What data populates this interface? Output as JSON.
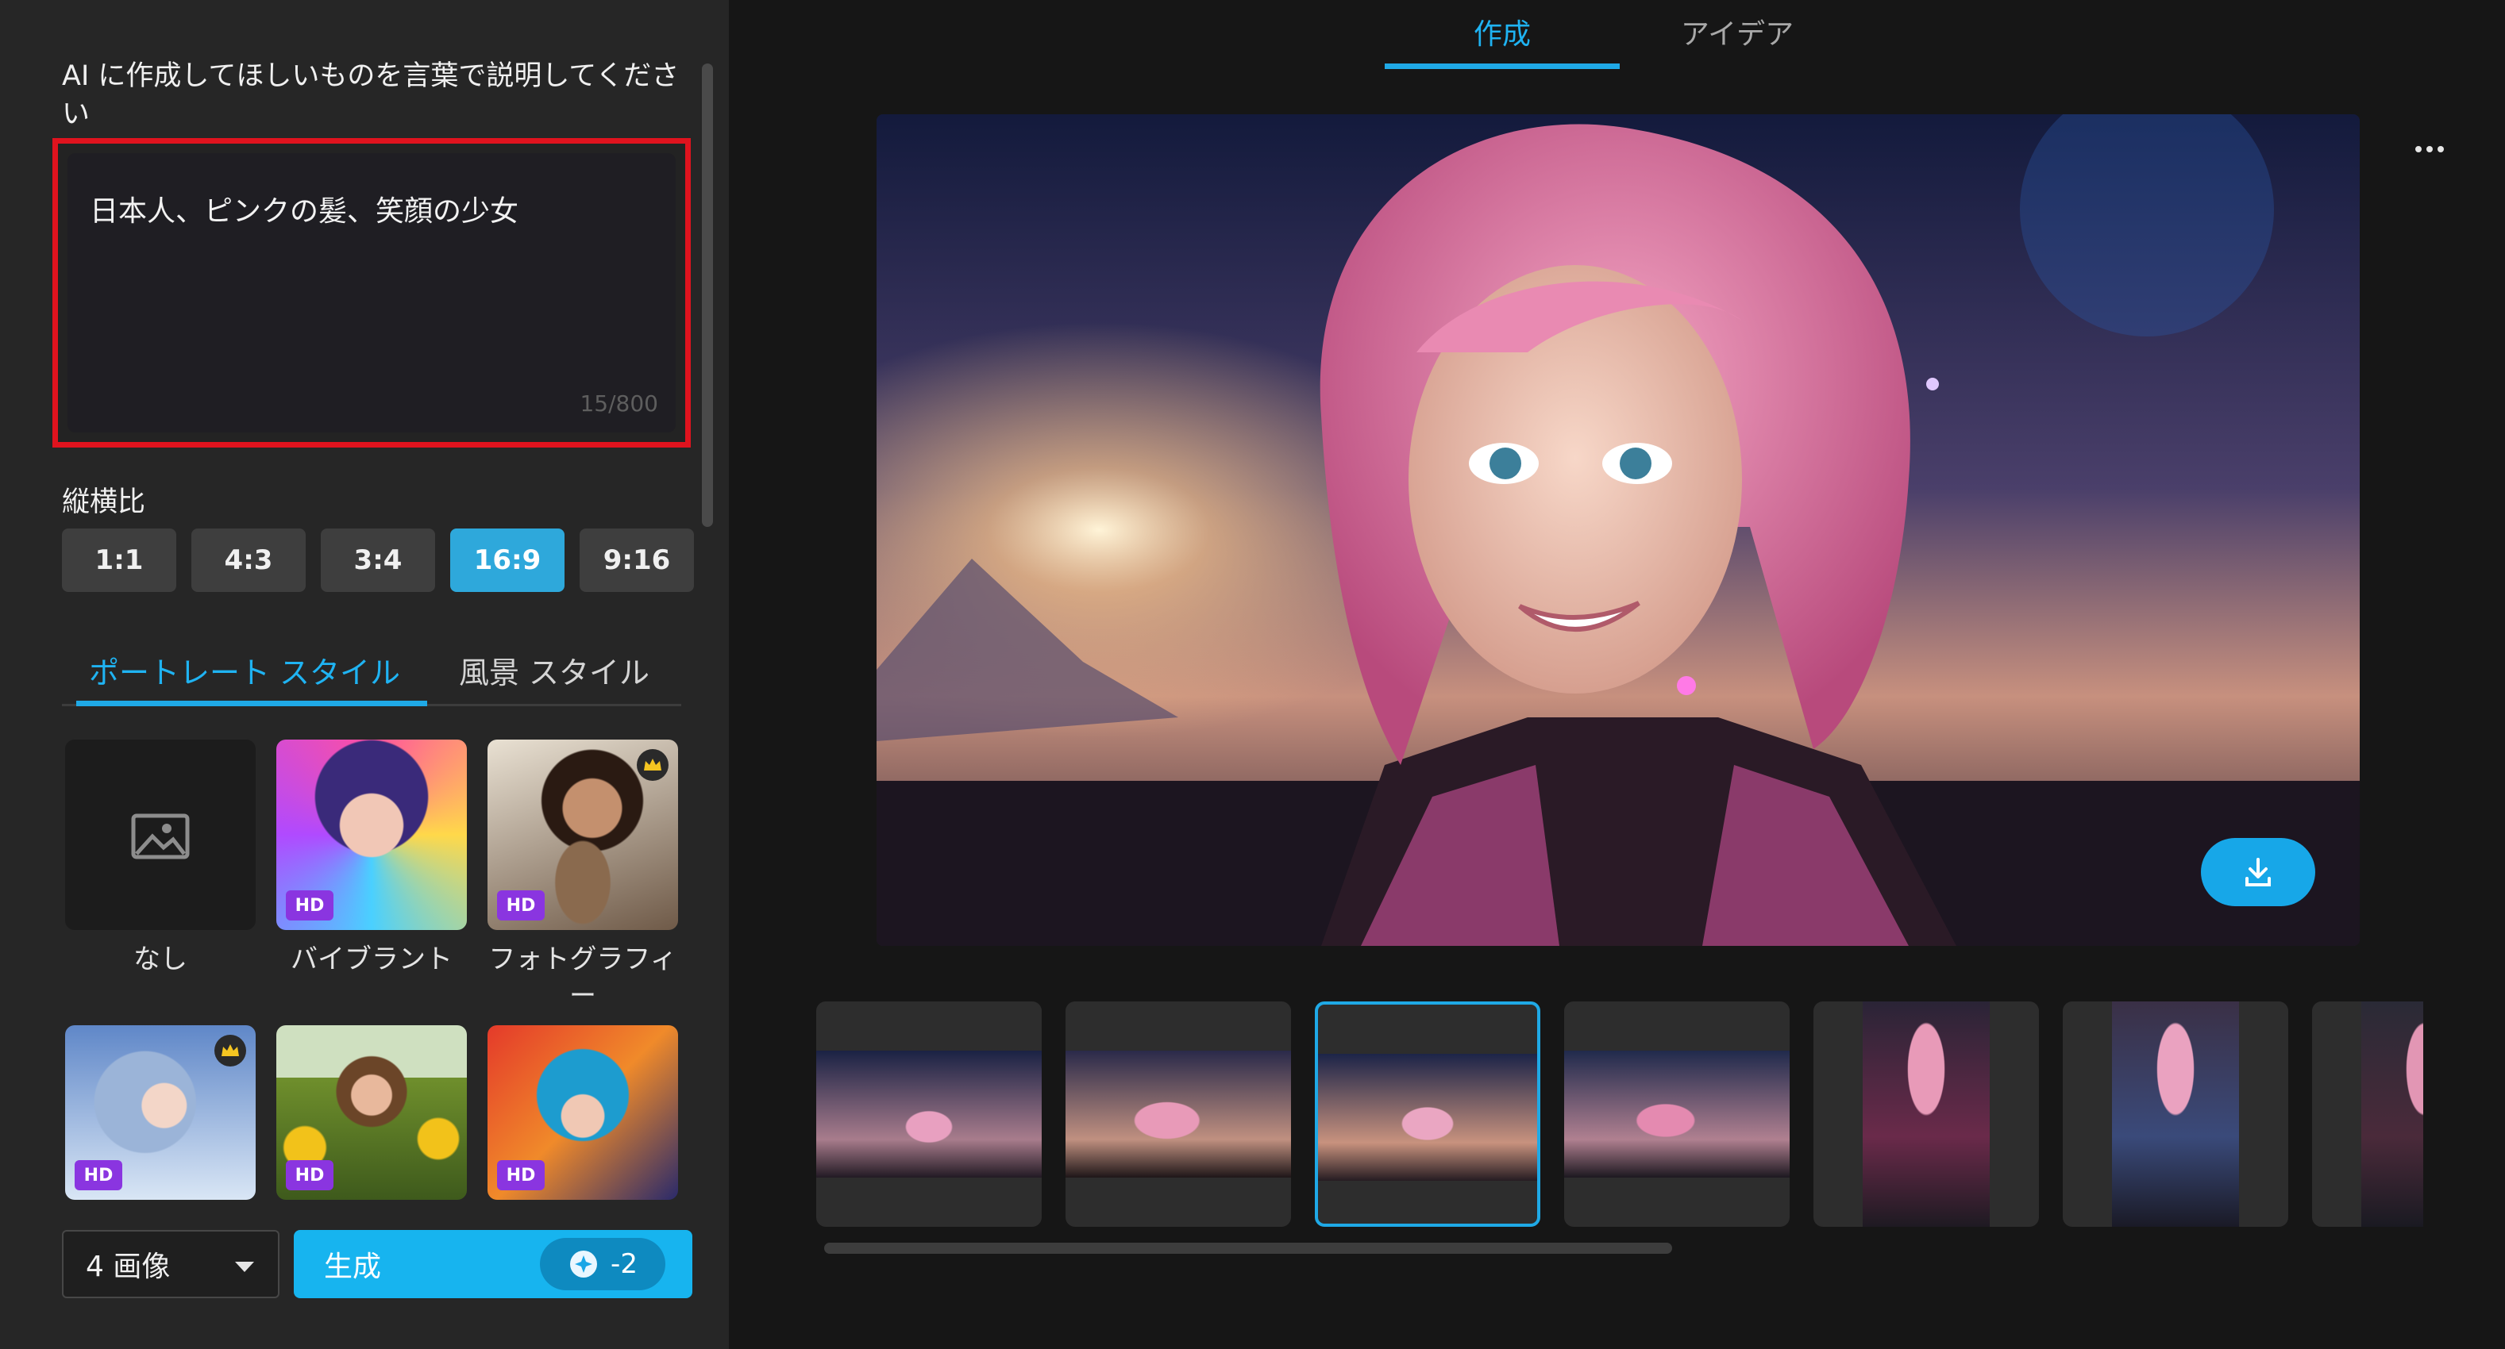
{
  "left_panel": {
    "prompt_label": "AI に作成してほしいものを言葉で説明してください",
    "prompt_value": "日本人、ピンクの髪、笑顔の少女",
    "prompt_counter": "15/800",
    "aspect_label": "縦横比",
    "ratios": [
      {
        "label": "1:1",
        "active": false
      },
      {
        "label": "4:3",
        "active": false
      },
      {
        "label": "3:4",
        "active": false
      },
      {
        "label": "16:9",
        "active": true
      },
      {
        "label": "9:16",
        "active": false
      }
    ],
    "style_tabs": [
      {
        "label": "ポートレート スタイル",
        "active": true
      },
      {
        "label": "風景 スタイル",
        "active": false
      }
    ],
    "styles": [
      {
        "name": "なし",
        "hd": false,
        "premium": false
      },
      {
        "name": "バイブラント",
        "hd": true,
        "premium": false
      },
      {
        "name": "フォトグラフィー",
        "hd": true,
        "premium": true
      },
      {
        "name": "",
        "hd": true,
        "premium": true
      },
      {
        "name": "",
        "hd": true,
        "premium": false
      },
      {
        "name": "",
        "hd": true,
        "premium": false
      }
    ],
    "hd_badge": "HD",
    "image_count": "4 画像",
    "generate_label": "生成",
    "generate_cost": "-2"
  },
  "top_tabs": [
    {
      "label": "作成",
      "active": true
    },
    {
      "label": "アイデア",
      "active": false
    }
  ],
  "icons": {
    "more": "more-horizontal-icon",
    "download": "download-icon",
    "no_image": "image-placeholder-icon",
    "crown": "crown-icon",
    "credit": "credit-icon"
  },
  "colors": {
    "accent": "#1fa9e6",
    "generate": "#17b4ef",
    "highlight_border": "#e0131e",
    "hd_badge": "#8a35e0",
    "panel": "#262626",
    "background": "#161616"
  }
}
